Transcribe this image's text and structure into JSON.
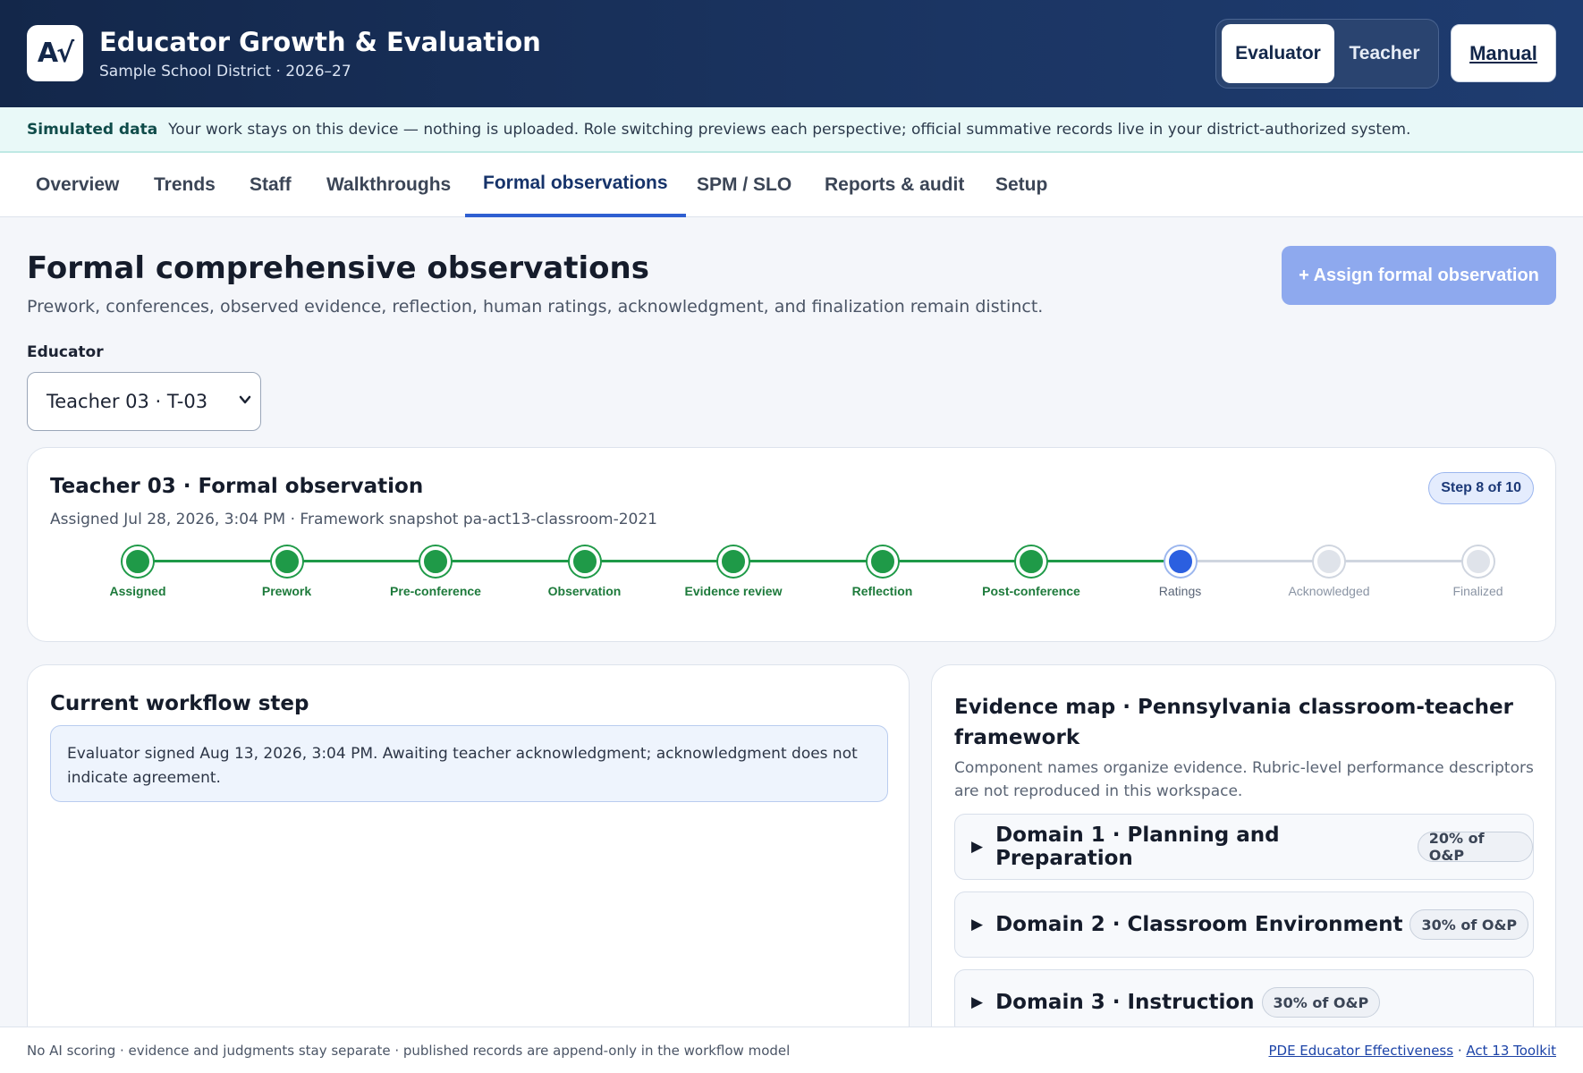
{
  "header": {
    "logo_text": "A√",
    "title": "Educator Growth & Evaluation",
    "subtitle": "Sample School District · 2026–27",
    "roles": [
      "Evaluator",
      "Teacher"
    ],
    "active_role": "Evaluator",
    "manual_label": "Manual"
  },
  "banner": {
    "label": "Simulated data",
    "text": "Your work stays on this device — nothing is uploaded. Role switching previews each perspective; official summative records live in your district-authorized system."
  },
  "tabs": [
    "Overview",
    "Trends",
    "Staff",
    "Walkthroughs",
    "Formal observations",
    "SPM / SLO",
    "Reports & audit",
    "Setup"
  ],
  "active_tab": "Formal observations",
  "page": {
    "title": "Formal comprehensive observations",
    "description": "Prework, conferences, observed evidence, reflection, human ratings, acknowledgment, and finalization remain distinct.",
    "assign_button": "+ Assign formal observation",
    "educator_label": "Educator",
    "educator_selected": "Teacher 03 · T-03"
  },
  "observation": {
    "title": "Teacher 03 · Formal observation",
    "subtitle": "Assigned Jul 28, 2026, 3:04 PM · Framework snapshot pa-act13-classroom-2021",
    "step_badge": "Step 8 of 10",
    "current_step": 8,
    "steps": [
      "Assigned",
      "Prework",
      "Pre-conference",
      "Observation",
      "Evidence review",
      "Reflection",
      "Post-conference",
      "Ratings",
      "Acknowledged",
      "Finalized"
    ]
  },
  "workflow": {
    "title": "Current workflow step",
    "note": "Evaluator signed Aug 13, 2026, 3:04 PM. Awaiting teacher acknowledgment; acknowledgment does not indicate agreement."
  },
  "evidence": {
    "title": "Evidence map · Pennsylvania classroom-teacher framework",
    "description": "Component names organize evidence. Rubric-level performance descriptors are not reproduced in this workspace.",
    "domains": [
      {
        "name": "Domain 1 · Planning and Preparation",
        "weight": "20% of O&P"
      },
      {
        "name": "Domain 2 · Classroom Environment",
        "weight": "30% of O&P"
      },
      {
        "name": "Domain 3 · Instruction",
        "weight": "30% of O&P"
      }
    ]
  },
  "footer": {
    "text": "No AI scoring · evidence and judgments stay separate · published records are append-only in the workflow model",
    "link1": "PDE Educator Effectiveness",
    "separator": " · ",
    "link2": "Act 13 Toolkit"
  },
  "colors": {
    "header_bg": "#13274a",
    "accent": "#2f5fd1",
    "done": "#1f9a48",
    "current": "#2b5fe0"
  }
}
